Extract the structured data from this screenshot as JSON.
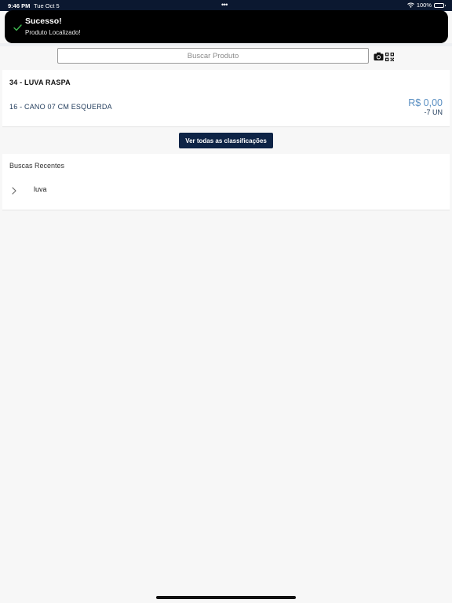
{
  "status_bar": {
    "time": "9:46 PM",
    "date": "Tue Oct 5",
    "dots": "•••",
    "battery": "100%"
  },
  "toast": {
    "title": "Sucesso!",
    "message": "Produto Localizado!",
    "icon": "check-icon"
  },
  "search": {
    "placeholder": "Buscar Produto",
    "value": ""
  },
  "product": {
    "title": "34 - LUVA RASPA",
    "variant": "16 - CANO 07 CM ESQUERDA",
    "price": "R$ 0,00",
    "quantity": "-7 UN"
  },
  "actions": {
    "view_all_label": "Ver todas as classificações"
  },
  "recent": {
    "title": "Buscas Recentes",
    "items": [
      {
        "label": "luva"
      }
    ]
  },
  "colors": {
    "navy": "#0e2446",
    "price_blue": "#5a8fc2",
    "toast_bg": "#000000",
    "success_green": "#3fb950"
  }
}
